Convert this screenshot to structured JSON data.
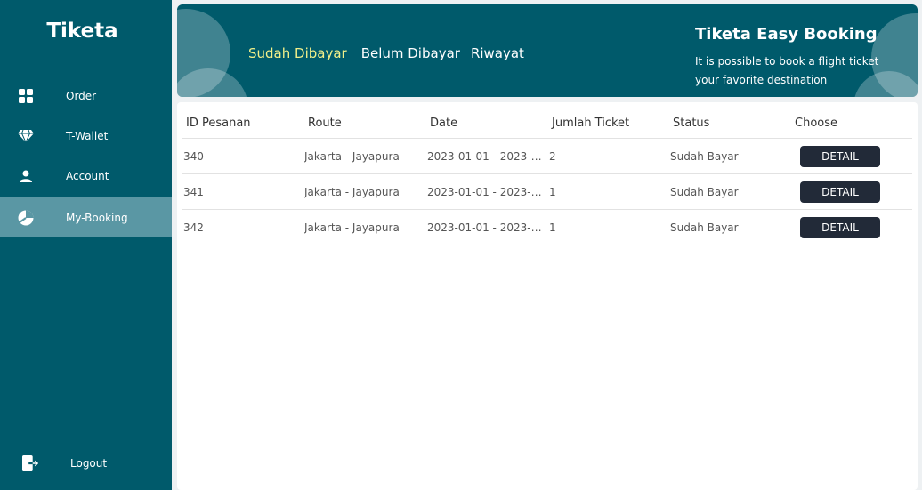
{
  "sidebar": {
    "brand": "Tiketa",
    "items": [
      {
        "label": "Order",
        "icon": "grid-icon",
        "active": false
      },
      {
        "label": "T-Wallet",
        "icon": "diamond-icon",
        "active": false
      },
      {
        "label": "Account",
        "icon": "user-icon",
        "active": false
      },
      {
        "label": "My-Booking",
        "icon": "pie-icon",
        "active": true
      }
    ],
    "logout": {
      "label": "Logout",
      "icon": "logout-icon"
    }
  },
  "header": {
    "tabs": [
      {
        "label": "Sudah Dibayar",
        "active": true
      },
      {
        "label": "Belum Dibayar",
        "active": false
      },
      {
        "label": "Riwayat",
        "active": false
      }
    ],
    "title": "Tiketa Easy Booking",
    "subtitle": "It is possible to book a flight ticket your favorite destination"
  },
  "table": {
    "columns": [
      "ID Pesanan",
      "Route",
      "Date",
      "Jumlah Ticket",
      "Status",
      "Choose"
    ],
    "rows": [
      {
        "id": "340",
        "route": "Jakarta - Jayapura",
        "date": "2023-01-01 - 2023-01-...",
        "tickets": "2",
        "status": "Sudah Bayar",
        "action": "DETAIL"
      },
      {
        "id": "341",
        "route": "Jakarta - Jayapura",
        "date": "2023-01-01 - 2023-01-...",
        "tickets": "1",
        "status": "Sudah Bayar",
        "action": "DETAIL"
      },
      {
        "id": "342",
        "route": "Jakarta - Jayapura",
        "date": "2023-01-01 - 2023-01-...",
        "tickets": "1",
        "status": "Sudah Bayar",
        "action": "DETAIL"
      }
    ]
  },
  "colors": {
    "primary": "#005a6b",
    "active_item": "#5a97a4",
    "active_tab": "#f2f08a",
    "button": "#222a38"
  }
}
